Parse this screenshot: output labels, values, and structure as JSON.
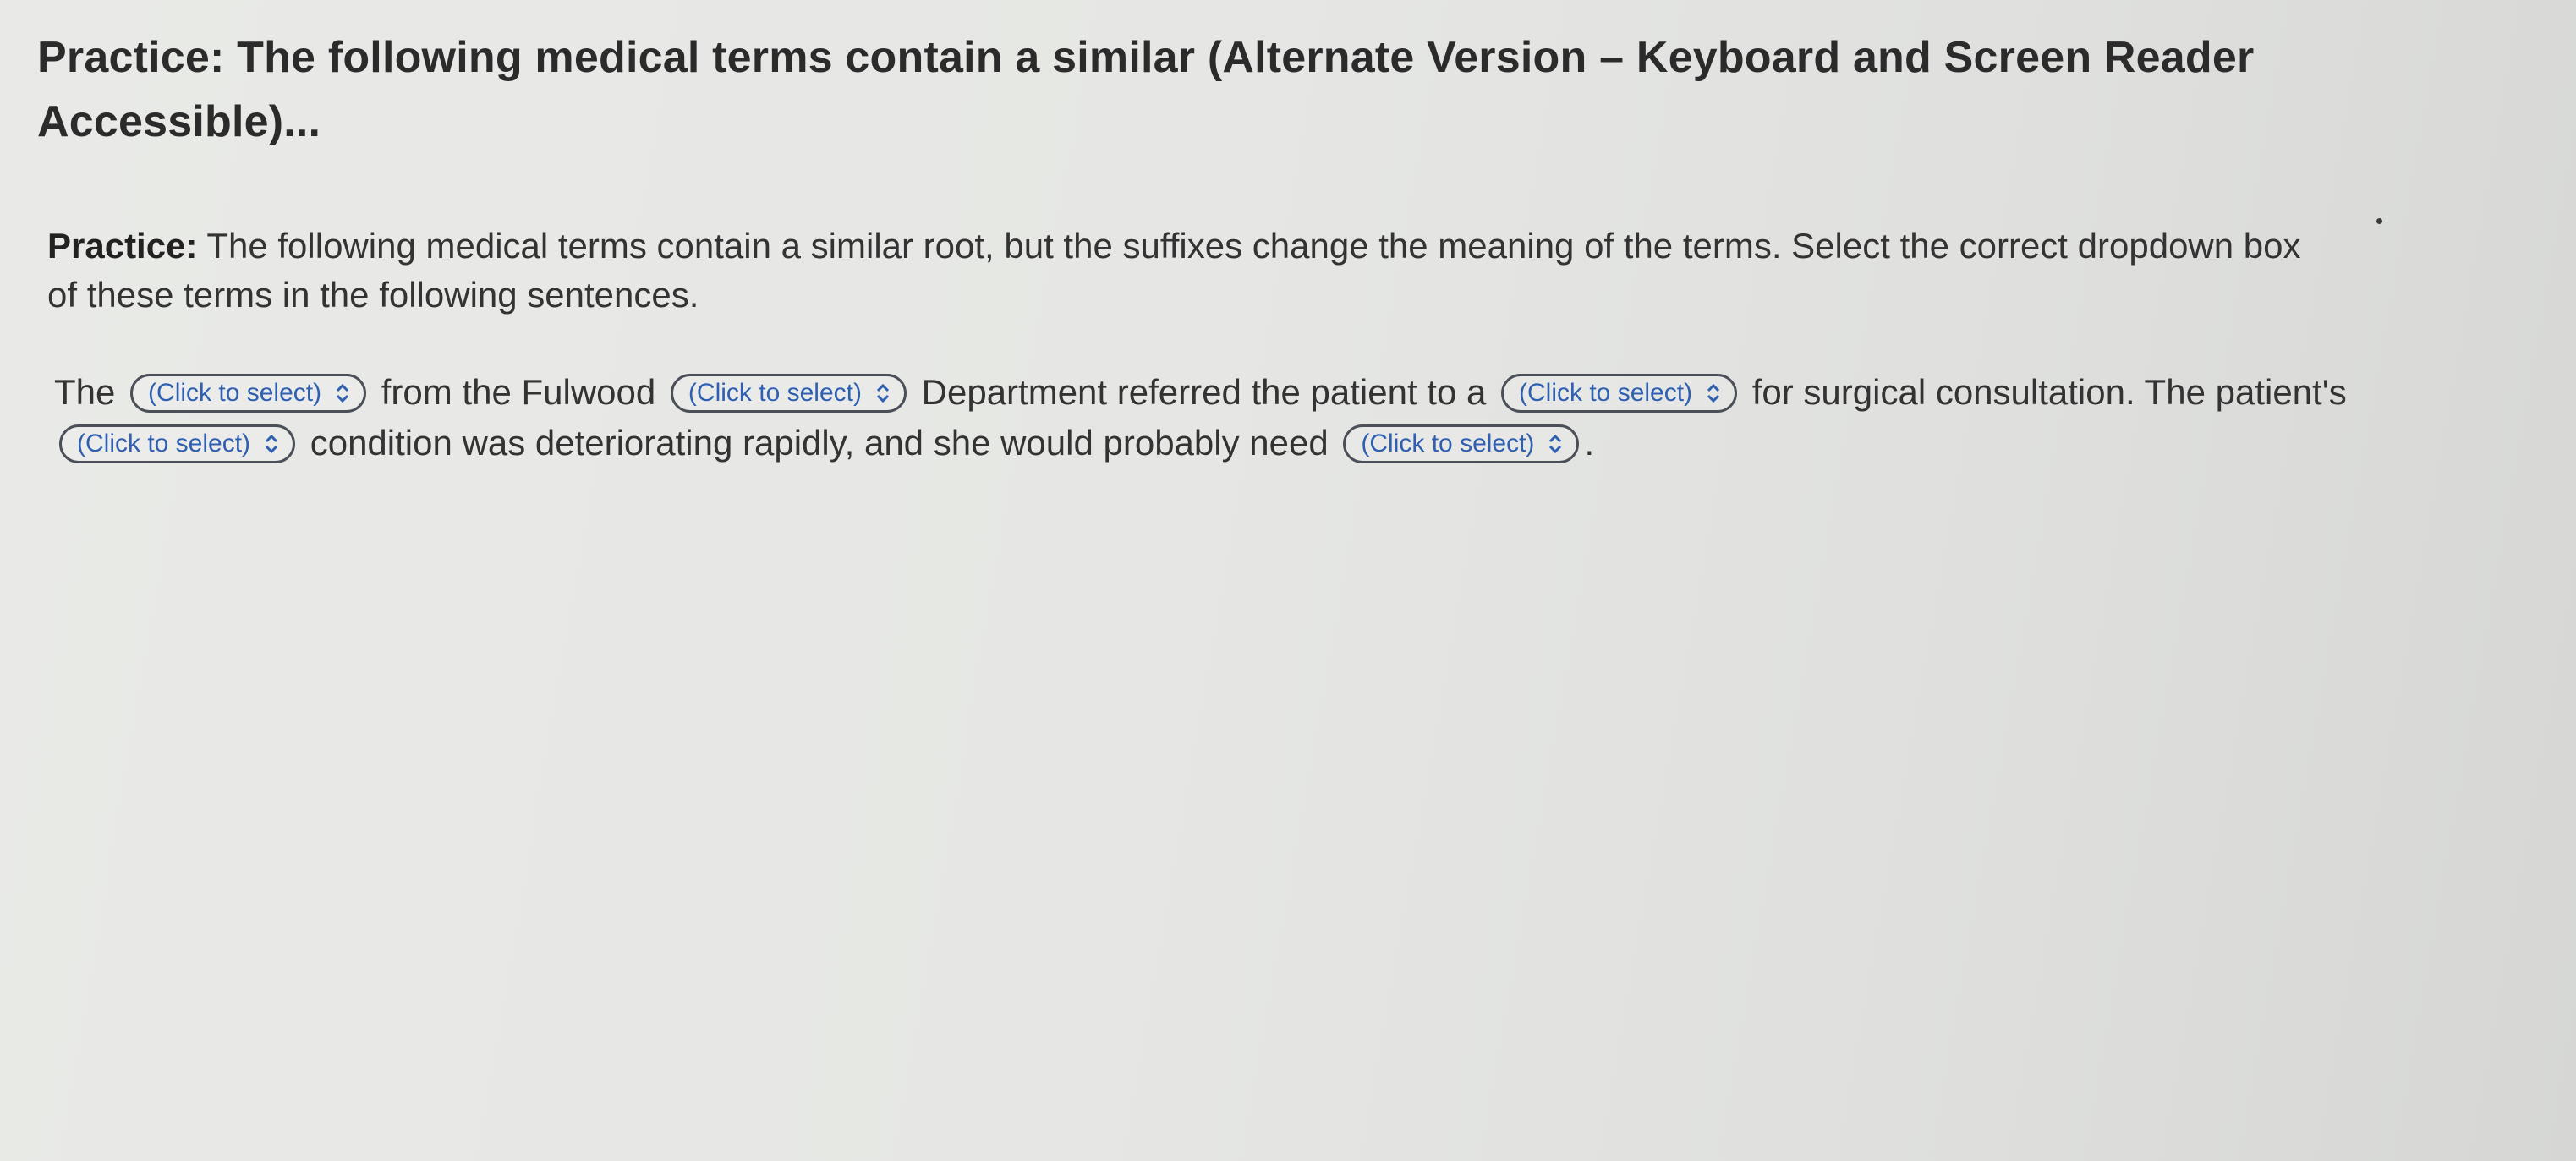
{
  "title": "Practice: The following medical terms contain a similar (Alternate Version – Keyboard and Screen Reader Accessible)...",
  "instructions": {
    "label": "Practice:",
    "text": " The following medical terms contain a similar root, but the suffixes change the meaning of the terms. Select the correct dropdown box of these terms in the following sentences."
  },
  "sentence": {
    "part1": "The",
    "part2": "from the Fulwood",
    "part3": "Department referred the patient to a",
    "part4": "for surgical consultation. The patient's",
    "part5": "condition was deteriorating rapidly, and she would probably need",
    "part6": "."
  },
  "dropdowns": [
    {
      "value": "(Click to select)",
      "icon": "chevron-updown-icon"
    },
    {
      "value": "(Click to select)",
      "icon": "chevron-updown-icon"
    },
    {
      "value": "(Click to select)",
      "icon": "chevron-updown-icon"
    },
    {
      "value": "(Click to select)",
      "icon": "chevron-updown-icon"
    },
    {
      "value": "(Click to select)",
      "icon": "chevron-updown-icon"
    }
  ],
  "colors": {
    "background": "#e6e7e4",
    "text": "#333333",
    "dropdown_text": "#2f5fb0",
    "dropdown_border": "#4a4f58"
  }
}
